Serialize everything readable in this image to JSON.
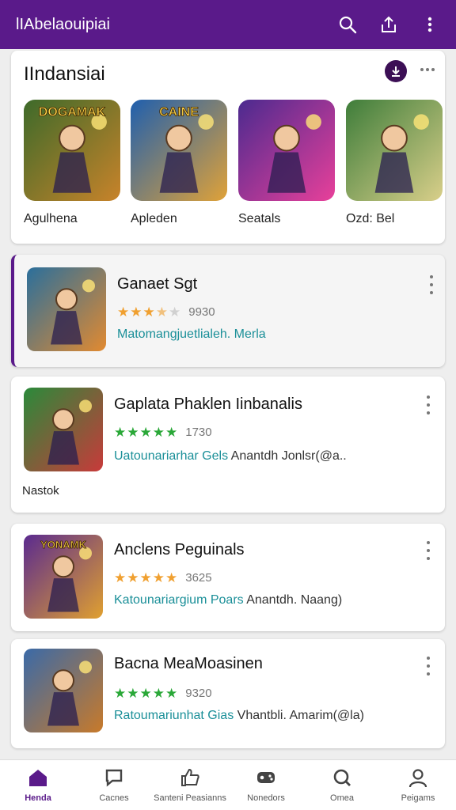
{
  "appbar": {
    "title": "lIAbelaouipiai",
    "icons": [
      "search-icon",
      "share-icon",
      "more-vert-icon"
    ]
  },
  "featured": {
    "title": "IIndansiai",
    "items": [
      {
        "label": "Agulhena",
        "art_text": "DOGAMAK",
        "colors": [
          "#3d6a2a",
          "#c8832a"
        ]
      },
      {
        "label": "Apleden",
        "art_text": "CAINE",
        "colors": [
          "#1f5fae",
          "#e0a238"
        ]
      },
      {
        "label": "Seatals",
        "art_text": "",
        "colors": [
          "#4b2a8f",
          "#e8409a"
        ]
      },
      {
        "label": "Ozd: Bel",
        "art_text": "",
        "colors": [
          "#3e7d3a",
          "#d9cf8a"
        ]
      }
    ]
  },
  "list": [
    {
      "title": "Ganaet Sgt",
      "stars": 3.5,
      "star_color": "#f0a030",
      "count": "9930",
      "desc": "Matomangjuetlialeh. Merla",
      "desc_plain": "",
      "art_text": "",
      "colors": [
        "#2a6f9c",
        "#e28a30"
      ]
    },
    {
      "title": "Gaplata Phaklen Iinbanalis",
      "stars": 5,
      "star_color": "#2aa838",
      "count": "1730",
      "desc": "Uatounariarhar Gels",
      "desc_plain": "Anantdh Jonlsr(@a..",
      "extra": "Nastok",
      "art_text": "",
      "colors": [
        "#2a8a3a",
        "#c83a3a"
      ]
    },
    {
      "title": "Anclens Peguinals",
      "stars": 5,
      "star_color": "#f0a030",
      "count": "3625",
      "desc": "Katounariargium Poars",
      "desc_plain": "Anantdh. Naang)",
      "art_text": "YONAMK",
      "colors": [
        "#5a2a8f",
        "#e0a030"
      ]
    },
    {
      "title": "Bacna MeaMoasinen",
      "stars": 5,
      "star_color": "#2aa838",
      "count": "9320",
      "desc": "Ratoumariunhat Gias",
      "desc_plain": "Vhantbli. Amarim(@la)",
      "art_text": "",
      "colors": [
        "#3a6aa8",
        "#c87a2a"
      ]
    }
  ],
  "bottom_nav": [
    {
      "label": "Henda",
      "icon": "home-icon",
      "active": true
    },
    {
      "label": "Cacnes",
      "icon": "chat-icon",
      "active": false
    },
    {
      "label": "Santeni Peasianns",
      "icon": "thumb-icon",
      "active": false
    },
    {
      "label": "Nonedors",
      "icon": "gamepad-icon",
      "active": false
    },
    {
      "label": "Omea",
      "icon": "search-icon",
      "active": false
    },
    {
      "label": "Peigams",
      "icon": "person-icon",
      "active": false
    }
  ],
  "colors": {
    "primary": "#5a1a8a",
    "accent_teal": "#1a8f98",
    "star_gold": "#f0a030",
    "star_green": "#2aa838"
  }
}
